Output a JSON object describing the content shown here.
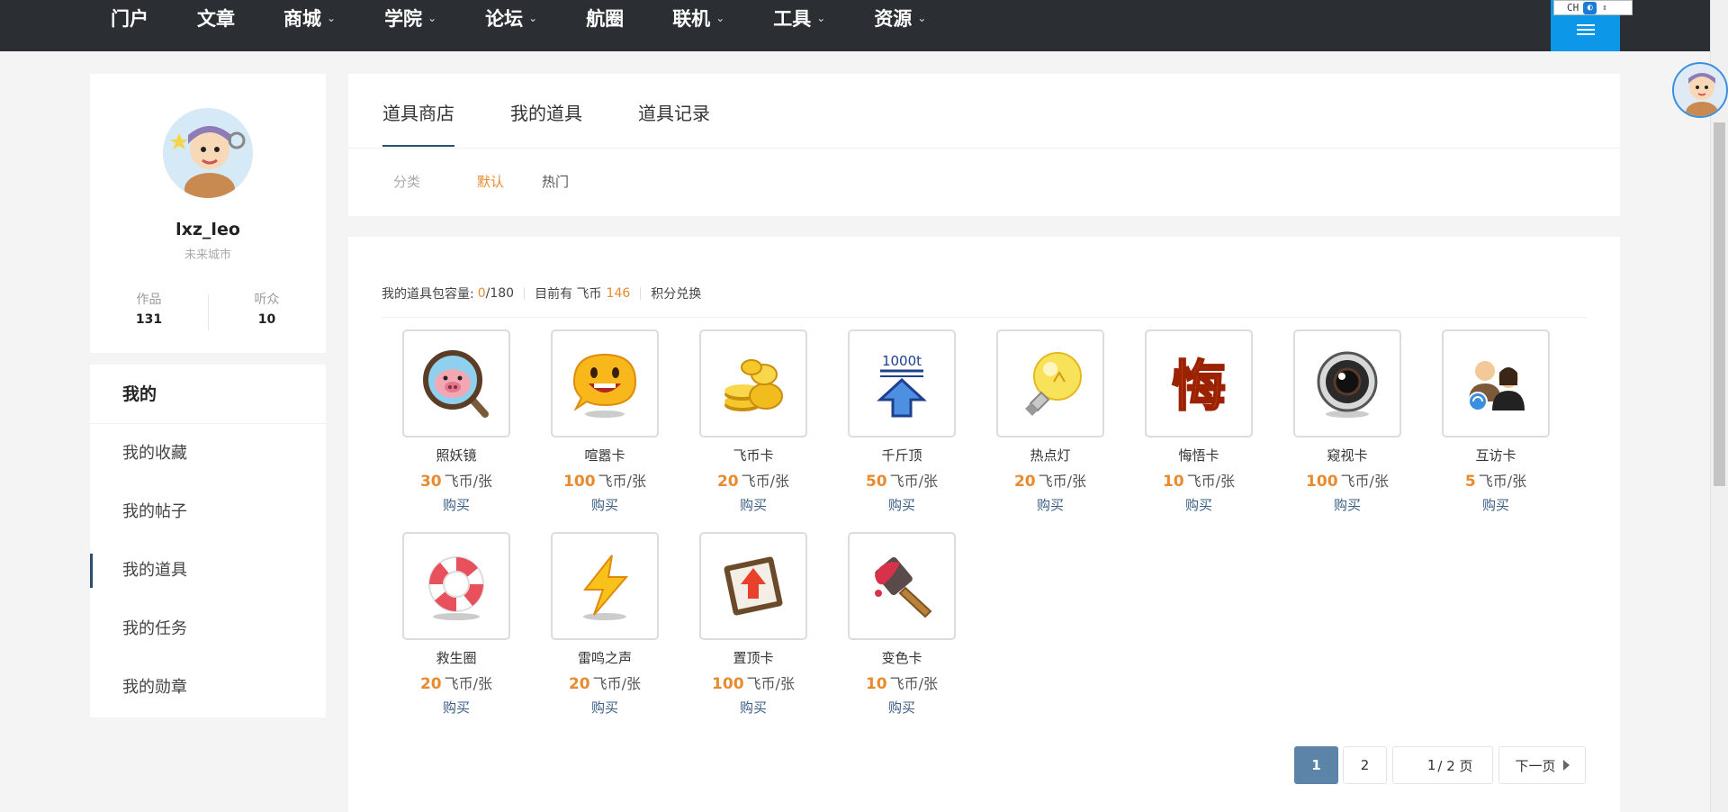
{
  "nav": {
    "items": [
      {
        "label": "门户",
        "chevron": false
      },
      {
        "label": "文章",
        "chevron": false
      },
      {
        "label": "商城",
        "chevron": true
      },
      {
        "label": "学院",
        "chevron": true
      },
      {
        "label": "论坛",
        "chevron": true
      },
      {
        "label": "航圈",
        "chevron": false
      },
      {
        "label": "联机",
        "chevron": true
      },
      {
        "label": "工具",
        "chevron": true
      },
      {
        "label": "资源",
        "chevron": true
      }
    ],
    "ime_label": "CH"
  },
  "profile": {
    "username": "lxz_leo",
    "title": "未来城市",
    "works_label": "作品",
    "works_value": "131",
    "fans_label": "听众",
    "fans_value": "10"
  },
  "sidebar": {
    "heading": "我的",
    "items": [
      "我的收藏",
      "我的帖子",
      "我的道具",
      "我的任务",
      "我的勋章"
    ],
    "active_index": 2
  },
  "tabs": {
    "items": [
      "道具商店",
      "我的道具",
      "道具记录"
    ],
    "active_index": 0
  },
  "subtabs": {
    "items": [
      "分类",
      "默认",
      "热门"
    ],
    "colors": [
      "#aaaaaa",
      "#e98a2f",
      "#555555"
    ]
  },
  "info": {
    "capacity_label": "我的道具包容量:",
    "capacity_used": "0",
    "capacity_total": "/180",
    "coins_label": "目前有 飞币",
    "coins_value": "146",
    "exchange_label": "积分兑换"
  },
  "items": [
    {
      "name": "照妖镜",
      "price": "30",
      "unit": "飞币/张",
      "buy": "购买",
      "icon": "magnifier-pig-icon"
    },
    {
      "name": "喧嚣卡",
      "price": "100",
      "unit": "飞币/张",
      "buy": "购买",
      "icon": "shouting-face-icon"
    },
    {
      "name": "飞币卡",
      "price": "20",
      "unit": "飞币/张",
      "buy": "购买",
      "icon": "gold-coins-icon"
    },
    {
      "name": "千斤顶",
      "price": "50",
      "unit": "飞币/张",
      "buy": "购买",
      "icon": "jack-1000t-icon"
    },
    {
      "name": "热点灯",
      "price": "20",
      "unit": "飞币/张",
      "buy": "购买",
      "icon": "light-bulb-icon"
    },
    {
      "name": "悔悟卡",
      "price": "10",
      "unit": "飞币/张",
      "buy": "购买",
      "icon": "regret-char-icon"
    },
    {
      "name": "窥视卡",
      "price": "100",
      "unit": "飞币/张",
      "buy": "购买",
      "icon": "peek-lens-icon"
    },
    {
      "name": "互访卡",
      "price": "5",
      "unit": "飞币/张",
      "buy": "购买",
      "icon": "visit-users-icon"
    },
    {
      "name": "救生圈",
      "price": "20",
      "unit": "飞币/张",
      "buy": "购买",
      "icon": "lifebuoy-icon"
    },
    {
      "name": "雷鸣之声",
      "price": "20",
      "unit": "飞币/张",
      "buy": "购买",
      "icon": "lightning-icon"
    },
    {
      "name": "置顶卡",
      "price": "100",
      "unit": "飞币/张",
      "buy": "购买",
      "icon": "pin-top-icon"
    },
    {
      "name": "变色卡",
      "price": "10",
      "unit": "飞币/张",
      "buy": "购买",
      "icon": "paint-brush-icon"
    }
  ],
  "icon_texts": {
    "jack_label": "1000t",
    "regret_char": "悔"
  },
  "pagination": {
    "page1": "1",
    "page2": "2",
    "jump_value": "1",
    "jump_total": " / 2 页",
    "next_label": "下一页"
  }
}
